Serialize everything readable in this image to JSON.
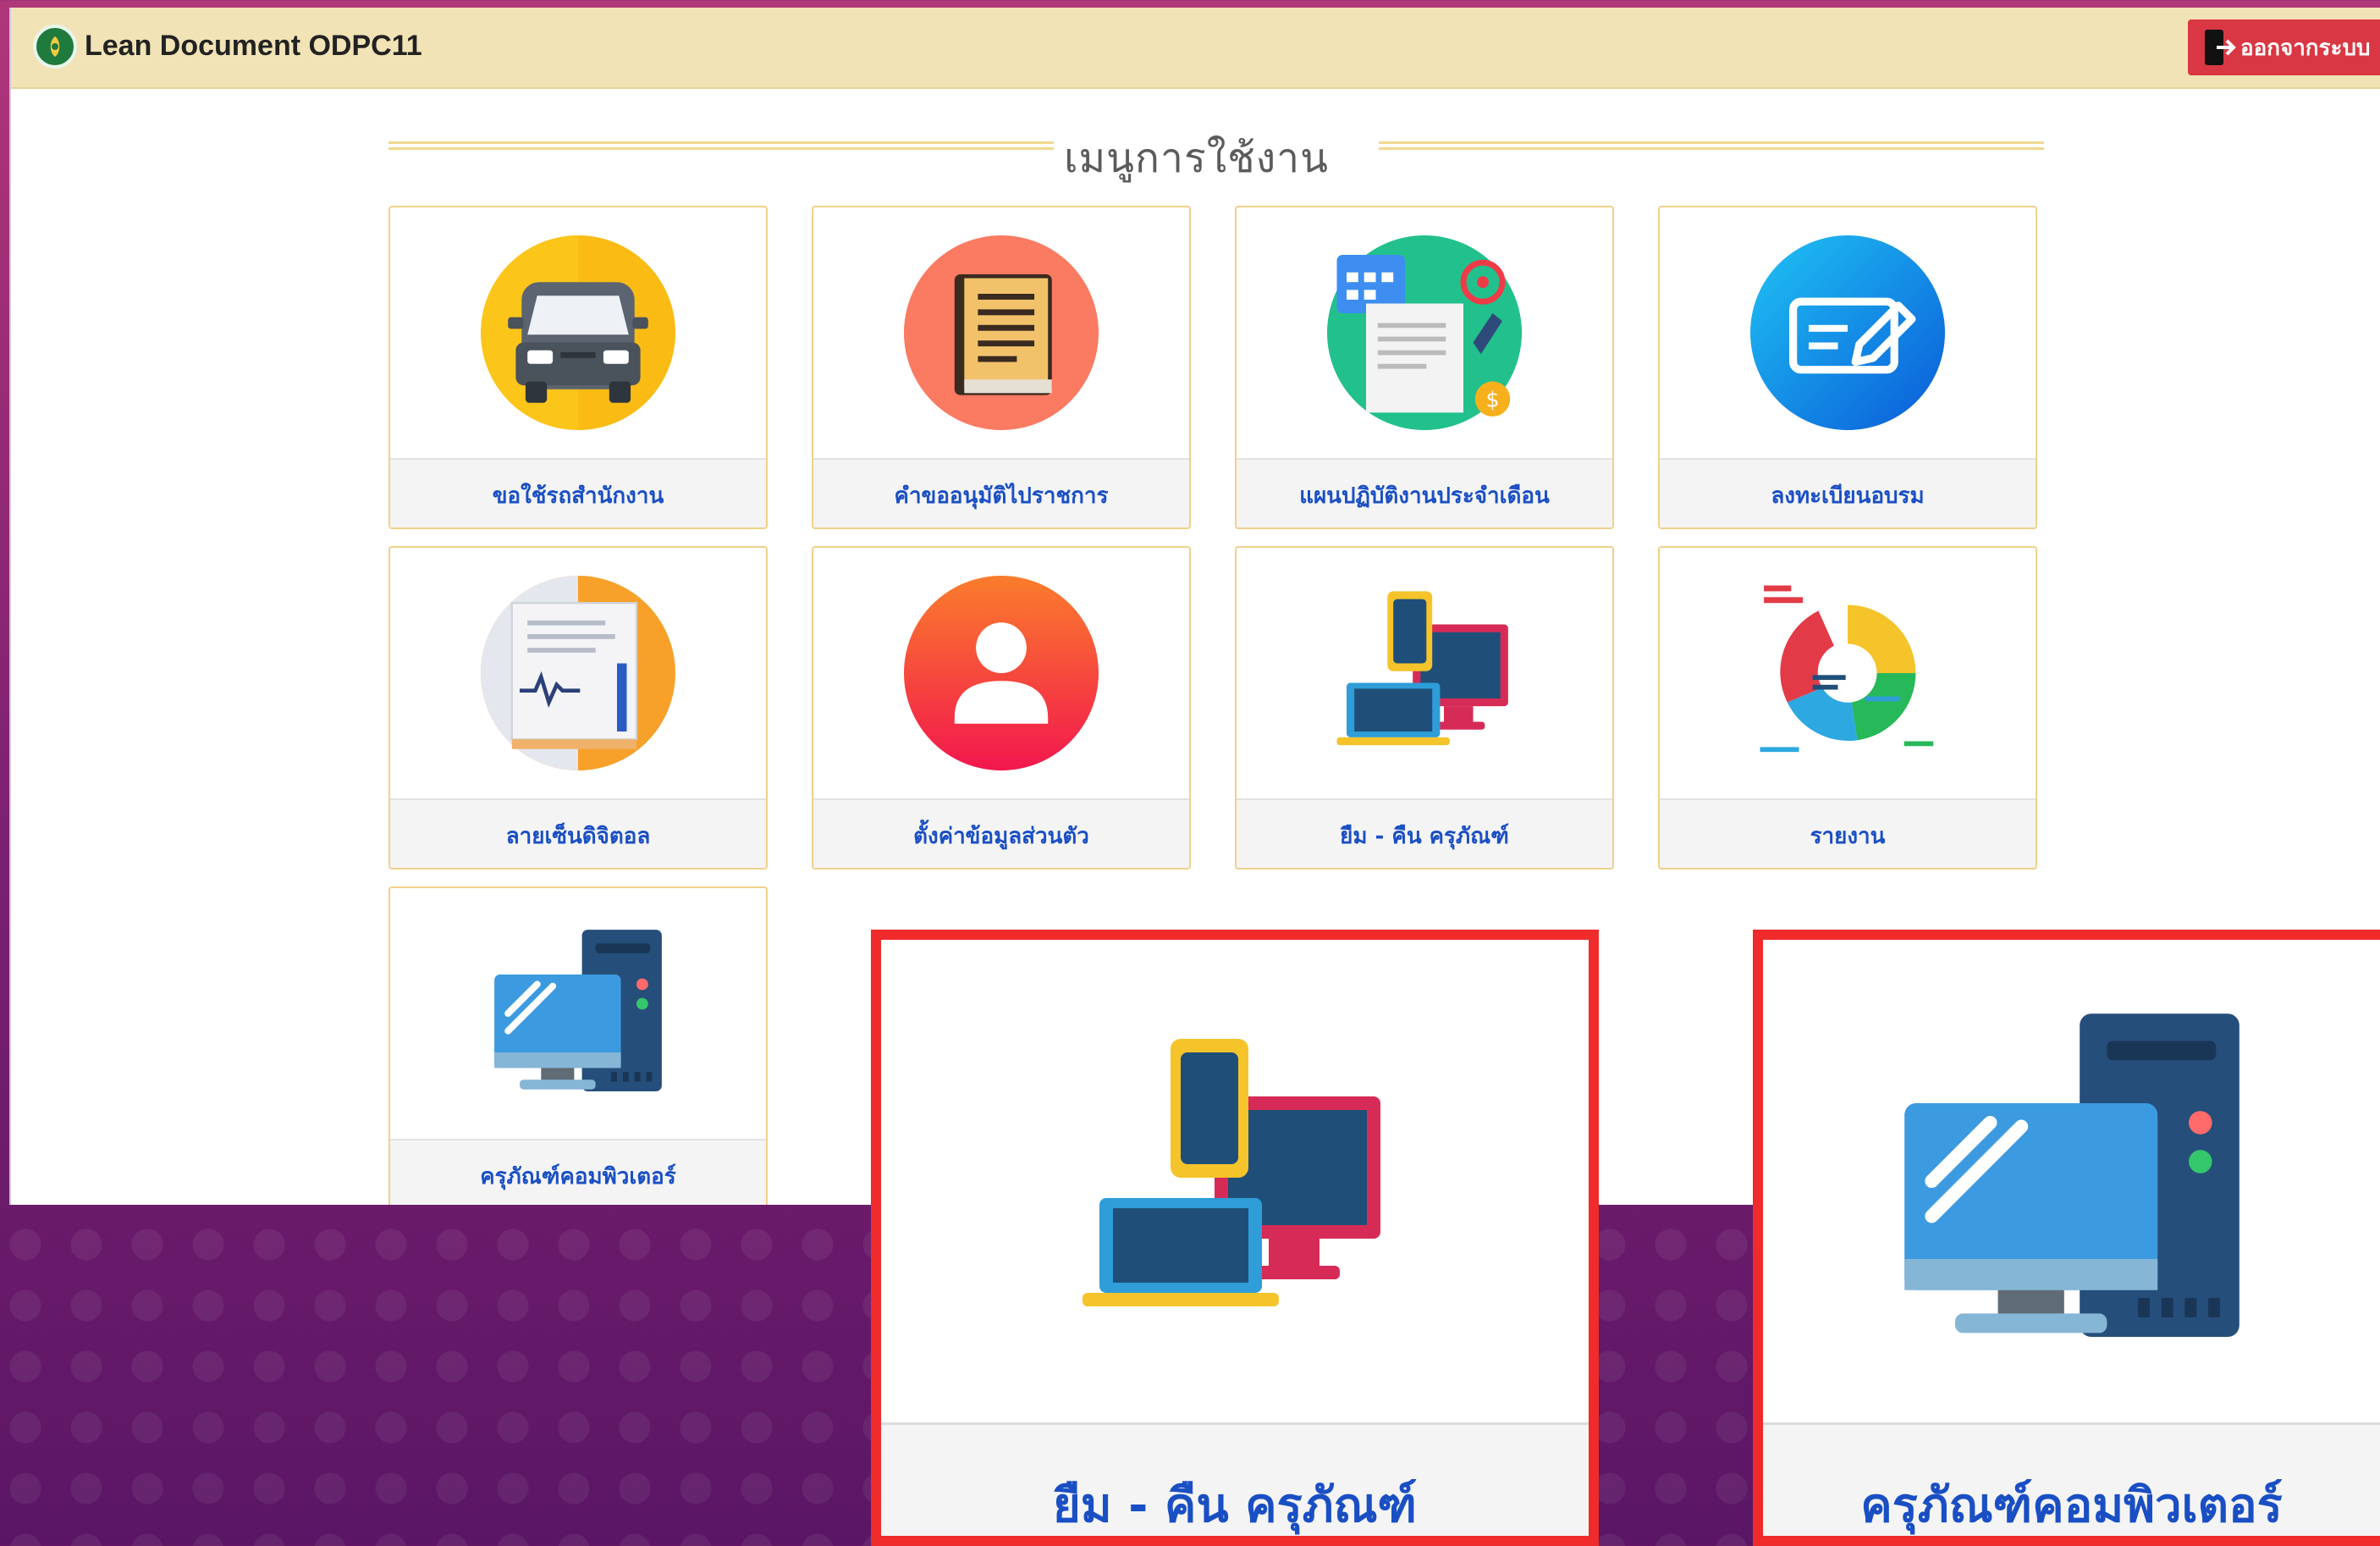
{
  "app": {
    "title": "Lean Document ODPC11",
    "logout_label": "ออกจากระบบ"
  },
  "menu": {
    "title": "เมนูการใช้งาน",
    "items": [
      {
        "label": "ขอใช้รถสำนักงาน",
        "icon": "van-icon"
      },
      {
        "label": "คำขออนุมัติไปราชการ",
        "icon": "book-icon"
      },
      {
        "label": "แผนปฏิบัติงานประจำเดือน",
        "icon": "plan-calendar-icon"
      },
      {
        "label": "ลงทะเบียนอบรม",
        "icon": "register-form-icon"
      },
      {
        "label": "ลายเซ็นดิจิตอล",
        "icon": "signature-document-icon"
      },
      {
        "label": "ตั้งค่าข้อมูลส่วนตัว",
        "icon": "user-profile-icon"
      },
      {
        "label": "ยืม - คืน ครุภัณฑ์",
        "icon": "devices-icon"
      },
      {
        "label": "รายงาน",
        "icon": "report-chart-icon"
      },
      {
        "label": "ครุภัณฑ์คอมพิวเตอร์",
        "icon": "desktop-computer-icon"
      }
    ]
  },
  "highlights": [
    {
      "label": "ยืม - คืน ครุภัณฑ์",
      "icon": "devices-icon",
      "highlight_color": "#ef2b2b"
    },
    {
      "label": "ครุภัณฑ์คอมพิวเตอร์",
      "icon": "desktop-computer-icon",
      "highlight_color": "#ef2b2b"
    }
  ]
}
